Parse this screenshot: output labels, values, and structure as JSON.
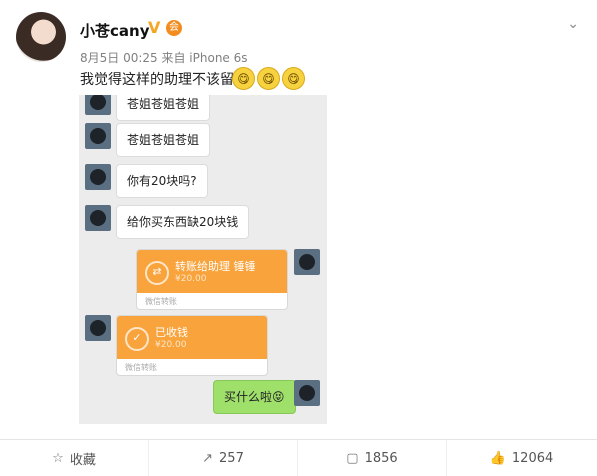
{
  "header": {
    "username": "小苍cany",
    "verified_badge": "V",
    "member_badge": "会",
    "meta": "8月5日 00:25 来自 iPhone 6s",
    "post_text": "我觉得这样的助理不该留",
    "emojis": [
      "😋",
      "😋",
      "😋"
    ],
    "dropdown_icon": "chevron-down-icon"
  },
  "chat": {
    "messages": [
      {
        "text": "苍姐苍姐苍姐",
        "side": "left",
        "type": "text"
      },
      {
        "text": "苍姐苍姐苍姐",
        "side": "left",
        "type": "text"
      },
      {
        "text": "你有20块吗?",
        "side": "left",
        "type": "text"
      },
      {
        "text": "给你买东西缺20块钱",
        "side": "left",
        "type": "text"
      },
      {
        "text": "转账给助理 锤锤",
        "amount": "¥20.00",
        "footer": "微信转账",
        "side": "right",
        "type": "transfer"
      },
      {
        "text": "已收钱",
        "amount": "¥20.00",
        "footer": "微信转账",
        "side": "left",
        "type": "transfer"
      },
      {
        "text": "买什么啦😝",
        "side": "right",
        "type": "text"
      }
    ]
  },
  "actions": [
    {
      "label": "收藏",
      "icon": "star-icon"
    },
    {
      "label": "257",
      "icon": "share-icon"
    },
    {
      "label": "1856",
      "icon": "comment-icon"
    },
    {
      "label": "12064",
      "icon": "like-icon"
    }
  ],
  "colors": {
    "accent_orange": "#f8a33b",
    "wechat_green": "#9fe06b",
    "chat_bg": "#ececec"
  }
}
